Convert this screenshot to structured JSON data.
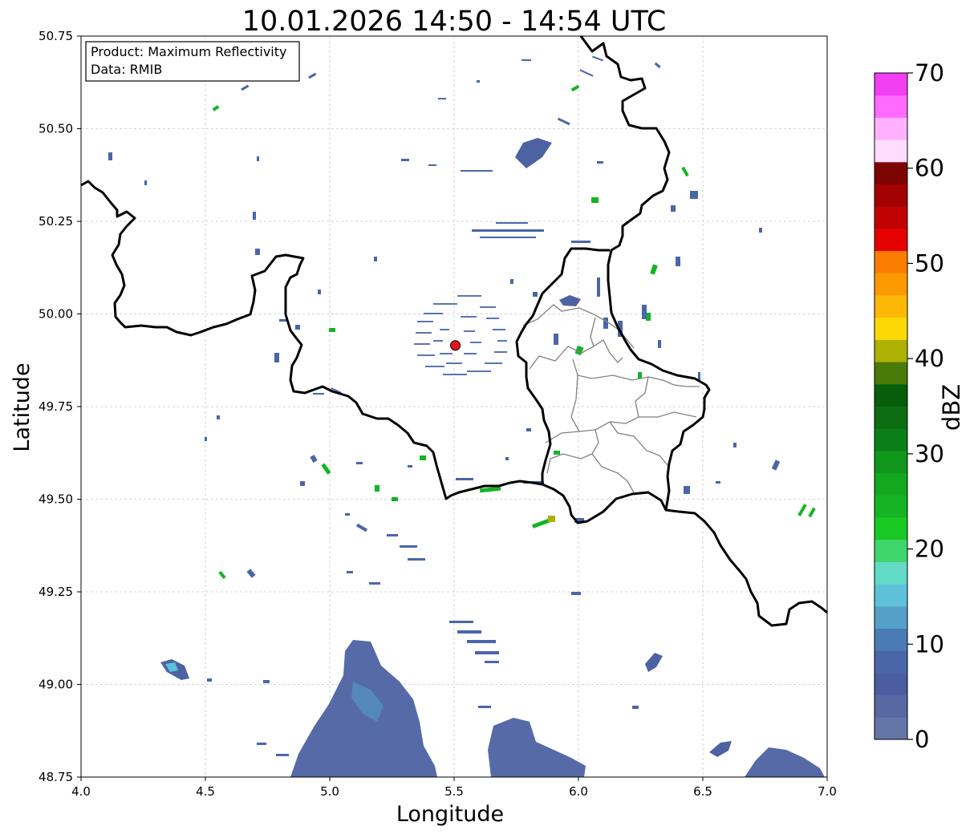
{
  "title": "10.01.2026 14:50 - 14:54 UTC",
  "xlabel": "Longitude",
  "ylabel": "Latitude",
  "info_box": {
    "product_line": "Product: Maximum Reflectivity",
    "data_line": "Data: RMIB"
  },
  "x_axis": {
    "min": 4.0,
    "max": 7.0,
    "ticks": [
      {
        "value": 4.0,
        "label": "4.0"
      },
      {
        "value": 4.5,
        "label": "4.5"
      },
      {
        "value": 5.0,
        "label": "5.0"
      },
      {
        "value": 5.5,
        "label": "5.5"
      },
      {
        "value": 6.0,
        "label": "6.0"
      },
      {
        "value": 6.5,
        "label": "6.5"
      },
      {
        "value": 7.0,
        "label": "7.0"
      }
    ]
  },
  "y_axis": {
    "min": 48.75,
    "max": 50.75,
    "ticks": [
      {
        "value": 48.75,
        "label": "48.75"
      },
      {
        "value": 49.0,
        "label": "49.00"
      },
      {
        "value": 49.25,
        "label": "49.25"
      },
      {
        "value": 49.5,
        "label": "49.50"
      },
      {
        "value": 49.75,
        "label": "49.75"
      },
      {
        "value": 50.0,
        "label": "50.00"
      },
      {
        "value": 50.25,
        "label": "50.25"
      },
      {
        "value": 50.5,
        "label": "50.50"
      },
      {
        "value": 50.75,
        "label": "50.75"
      }
    ]
  },
  "grid": true,
  "radar_site": {
    "lon": 5.505,
    "lat": 49.915,
    "color": "#e8141b"
  },
  "colorbar": {
    "label": "dBZ",
    "min": 0,
    "max": 70,
    "colors": [
      "#6475a8",
      "#5768a3",
      "#4b5da0",
      "#4a66a8",
      "#4a7bb4",
      "#56a0c8",
      "#5ec1d9",
      "#62dac6",
      "#3fd66c",
      "#18c823",
      "#14b424",
      "#12a81f",
      "#0f961b",
      "#0b7f17",
      "#0c6d13",
      "#075d0c",
      "#4a7a07",
      "#adb104",
      "#fcd905",
      "#fdb805",
      "#fd9a02",
      "#fc7d02",
      "#e40100",
      "#c00200",
      "#a20302",
      "#7d0202",
      "#ffdcff",
      "#ffb1ff",
      "#ff6bff",
      "#f23ff2"
    ],
    "ticks": [
      {
        "value": 0,
        "label": "0"
      },
      {
        "value": 10,
        "label": "10"
      },
      {
        "value": 20,
        "label": "20"
      },
      {
        "value": 30,
        "label": "30"
      },
      {
        "value": 40,
        "label": "40"
      },
      {
        "value": 50,
        "label": "50"
      },
      {
        "value": 60,
        "label": "60"
      },
      {
        "value": 70,
        "label": "70"
      }
    ]
  },
  "colors": {
    "border": "#000000",
    "province_border": "#808080",
    "grid": "#c8c8c8",
    "echo_weak": "#4a66a8",
    "echo_light": "#56a0c8",
    "echo_green": "#14b424",
    "echo_yellow": "#adb104"
  }
}
